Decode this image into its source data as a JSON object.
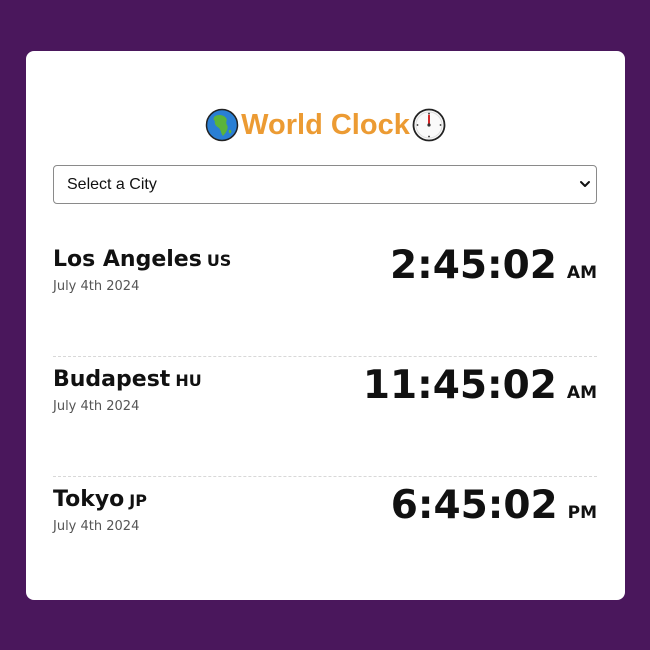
{
  "header": {
    "title": "World Clock",
    "left_icon": "globe-africa-icon",
    "right_icon": "clock-twelve-icon"
  },
  "city_select": {
    "value": "Select a City",
    "icon": "chevron-down-icon"
  },
  "cities": [
    {
      "name": "Los Angeles",
      "code": "US",
      "date": "July 4th 2024",
      "time": "2:45:02",
      "ampm": "AM"
    },
    {
      "name": "Budapest",
      "code": "HU",
      "date": "July 4th 2024",
      "time": "11:45:02",
      "ampm": "AM"
    },
    {
      "name": "Tokyo",
      "code": "JP",
      "date": "July 4th 2024",
      "time": "6:45:02",
      "ampm": "PM"
    }
  ],
  "colors": {
    "background": "#4a175c",
    "card": "#ffffff",
    "title": "#ec9b33"
  }
}
